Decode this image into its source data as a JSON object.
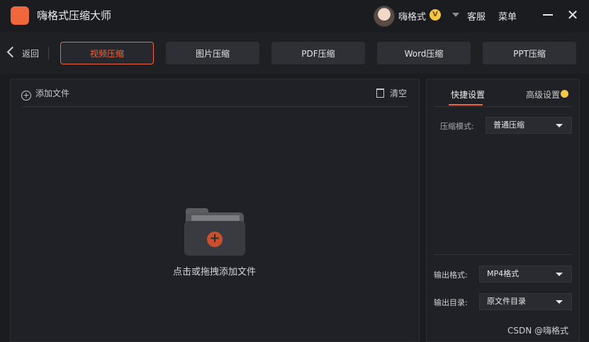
{
  "app": {
    "title": "嗨格式压缩大师",
    "user_name": "嗨格式",
    "vip_mark": "V",
    "customer_service": "客服",
    "menu": "菜单",
    "brand_color": "#f0663d"
  },
  "nav": {
    "back": "返回",
    "tabs": [
      {
        "label": "视频压缩",
        "active": true
      },
      {
        "label": "图片压缩",
        "active": false
      },
      {
        "label": "PDF压缩",
        "active": false
      },
      {
        "label": "Word压缩",
        "active": false
      },
      {
        "label": "PPT压缩",
        "active": false
      }
    ]
  },
  "file_panel": {
    "add_file": "添加文件",
    "clear": "清空",
    "drop_hint": "点击或拖拽添加文件"
  },
  "settings_panel": {
    "tabs": [
      {
        "label": "快捷设置",
        "active": true
      },
      {
        "label": "高级设置",
        "active": false
      }
    ],
    "compress_mode_label": "压缩模式:",
    "compress_mode_value": "普通压缩",
    "output_format_label": "输出格式:",
    "output_format_value": "MP4格式",
    "output_dir_label": "输出目录:",
    "output_dir_value": "原文件目录"
  },
  "watermark": "CSDN @嗨格式"
}
